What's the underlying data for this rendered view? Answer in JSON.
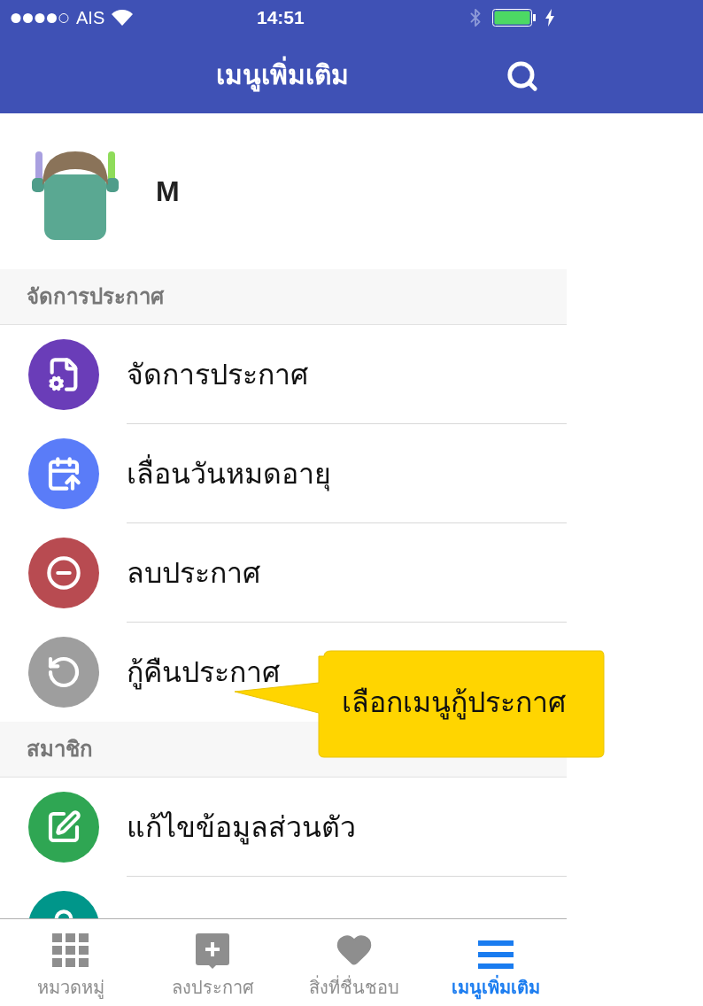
{
  "status_bar": {
    "carrier": "AIS",
    "time": "14:51"
  },
  "nav": {
    "title": "เมนูเพิ่มเติม"
  },
  "profile": {
    "name": "M"
  },
  "sections": [
    {
      "title": "จัดการประกาศ",
      "items": [
        {
          "label": "จัดการประกาศ",
          "color": "#6a3db8"
        },
        {
          "label": "เลื่อนวันหมดอายุ",
          "color": "#5a7cf8"
        },
        {
          "label": "ลบประกาศ",
          "color": "#b84b51"
        },
        {
          "label": "กู้คืนประกาศ",
          "color": "#9e9e9e"
        }
      ]
    },
    {
      "title": "สมาชิก",
      "items": [
        {
          "label": "แก้ไขข้อมูลส่วนตัว",
          "color": "#2fa653"
        },
        {
          "color": "#00968a"
        }
      ]
    }
  ],
  "callout": {
    "text": "เลือกเมนูกู้ประกาศ"
  },
  "tabs": [
    {
      "label": "หมวดหมู่",
      "selected": false
    },
    {
      "label": "ลงประกาศ",
      "selected": false
    },
    {
      "label": "สิ่งที่ชื่นชอบ",
      "selected": false
    },
    {
      "label": "เมนูเพิ่มเติม",
      "selected": true
    }
  ]
}
